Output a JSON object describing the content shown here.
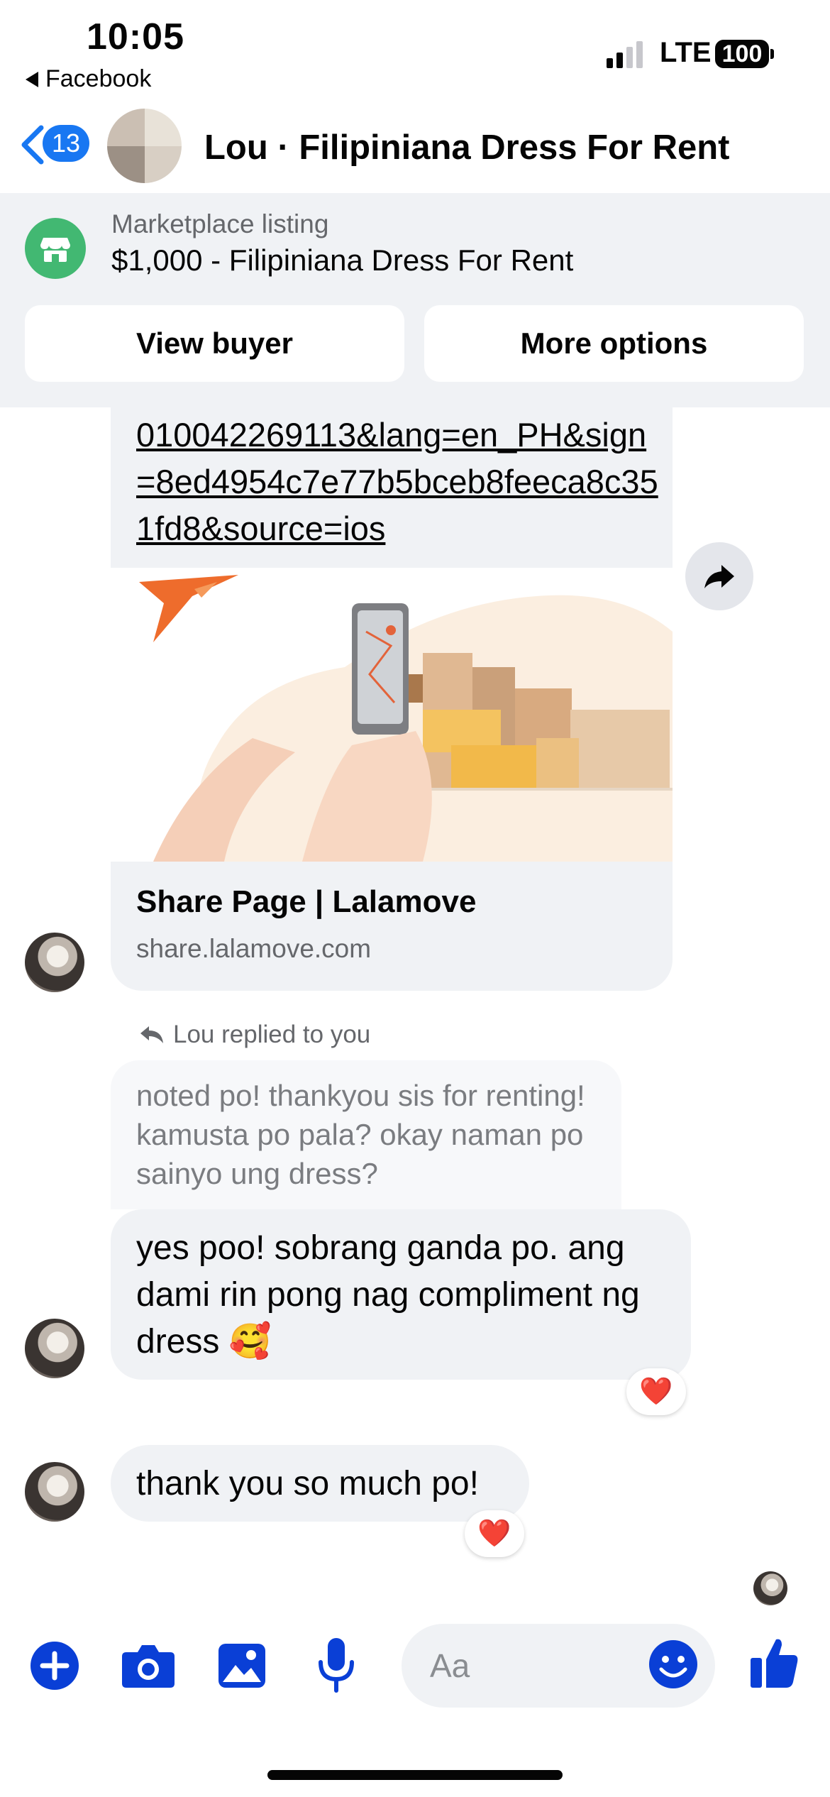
{
  "status_bar": {
    "time": "10:05",
    "back_app": "Facebook",
    "network": "LTE",
    "battery": "100"
  },
  "header": {
    "unread_count": "13",
    "title": "Lou · Filipiniana Dress For Rent"
  },
  "marketplace": {
    "label": "Marketplace listing",
    "title": "$1,000 - Filipiniana Dress For Rent",
    "view_buyer_label": "View buyer",
    "more_options_label": "More options"
  },
  "messages": {
    "link_text": "010042269113&lang=en_PH&sign=8ed4954c7e77b5bceb8feeca8c351fd8&source=ios",
    "preview_title": "Share Page | Lalamove",
    "preview_domain": "share.lalamove.com",
    "replied_label": "Lou replied to you",
    "quoted_text": "noted po! thankyou sis for renting! kamusta po pala? okay naman po sainyo ung dress?",
    "reply_text": "yes poo! sobrang ganda po. ang dami rin pong nag compliment ng dress 🥰",
    "reply_reaction": "❤️",
    "thanks_text": "thank you so much po!",
    "thanks_reaction": "❤️"
  },
  "composer": {
    "placeholder": "Aa",
    "icons": [
      "plus-icon",
      "camera-icon",
      "photo-icon",
      "microphone-icon",
      "emoji-icon",
      "thumbs-up-icon"
    ],
    "accent_color": "#0a3fd6"
  },
  "colors": {
    "brand_blue": "#1877f2",
    "marketplace_green": "#42b872",
    "bubble_gray": "#f0f2f5",
    "heart_red": "#e41e3f"
  }
}
